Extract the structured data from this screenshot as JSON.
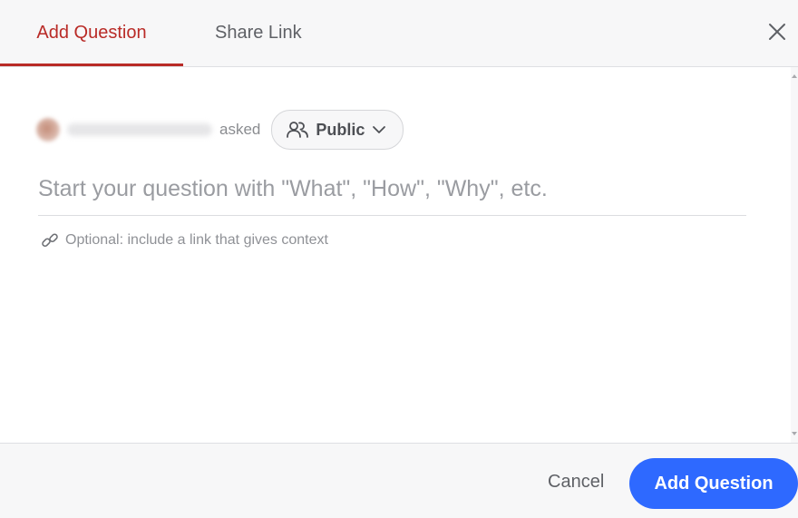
{
  "tabs": [
    {
      "label": "Add Question",
      "active": true
    },
    {
      "label": "Share Link",
      "active": false
    }
  ],
  "close_icon": "close-icon",
  "asker": {
    "asked_label": "asked",
    "visibility_label": "Public",
    "visibility_icon": "people-icon",
    "dropdown_icon": "chevron-down-icon"
  },
  "question": {
    "value": "",
    "placeholder": "Start your question with \"What\", \"How\", \"Why\", etc."
  },
  "context_link": {
    "icon": "link-icon",
    "value": "",
    "placeholder": "Optional: include a link that gives context"
  },
  "footer": {
    "cancel_label": "Cancel",
    "submit_label": "Add Question"
  },
  "colors": {
    "accent_red": "#b92b27",
    "primary_blue": "#2e69ff",
    "header_bg": "#f7f7f8"
  }
}
